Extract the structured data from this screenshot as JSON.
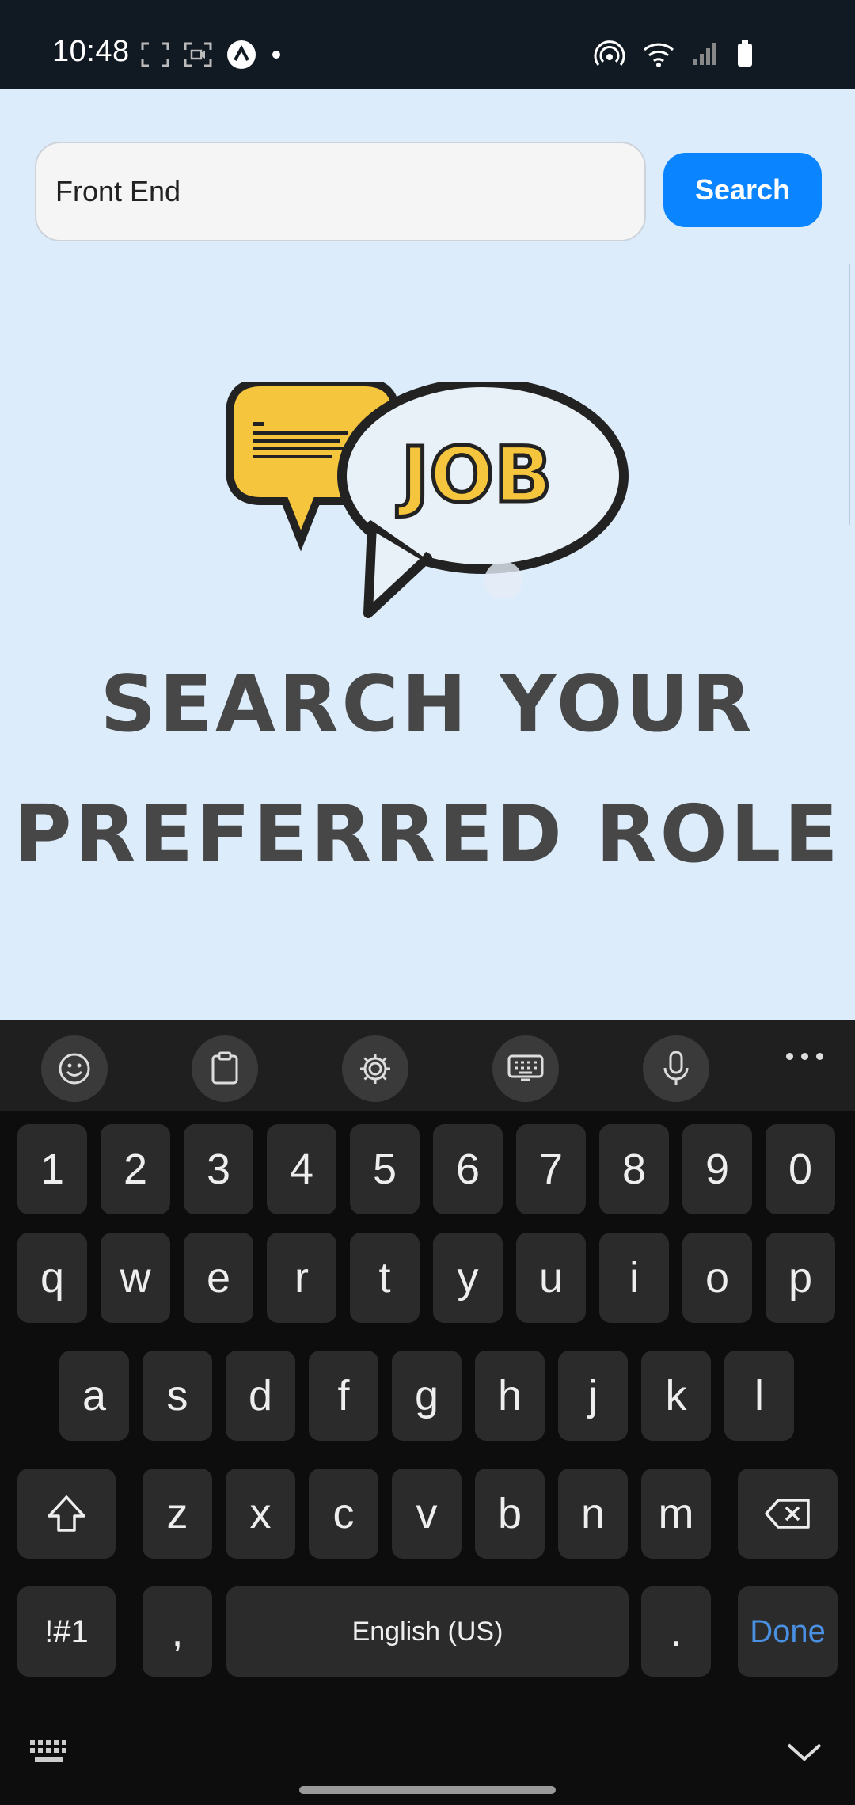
{
  "status_bar": {
    "time": "10:48",
    "left_icons": [
      "screenshot-icon",
      "screen-record-icon",
      "app-notification-icon",
      "dot-icon"
    ],
    "right_icons": [
      "hotspot-icon",
      "wifi-icon",
      "signal-icon",
      "battery-icon"
    ]
  },
  "search": {
    "value": "Front End",
    "button_label": "Search"
  },
  "hero": {
    "logo_text": "JOB",
    "headline_line1": "SEARCH YOUR",
    "headline_line2": "PREFERRED ROLE"
  },
  "keyboard": {
    "toolbar": [
      "emoji-icon",
      "clipboard-icon",
      "settings-icon",
      "keyboard-mode-icon",
      "mic-icon",
      "more-icon"
    ],
    "row_numbers": [
      "1",
      "2",
      "3",
      "4",
      "5",
      "6",
      "7",
      "8",
      "9",
      "0"
    ],
    "row_qwerty": [
      "q",
      "w",
      "e",
      "r",
      "t",
      "y",
      "u",
      "i",
      "o",
      "p"
    ],
    "row_asdf": [
      "a",
      "s",
      "d",
      "f",
      "g",
      "h",
      "j",
      "k",
      "l"
    ],
    "row_zxcv": [
      "z",
      "x",
      "c",
      "v",
      "b",
      "n",
      "m"
    ],
    "symbols_label": "!#1",
    "comma": ",",
    "space_label": "English (US)",
    "period": ".",
    "done_label": "Done"
  },
  "colors": {
    "accent": "#0a84ff",
    "app_background": "#dcecfb",
    "logo_yellow": "#f5c53d",
    "headline": "#474747"
  }
}
